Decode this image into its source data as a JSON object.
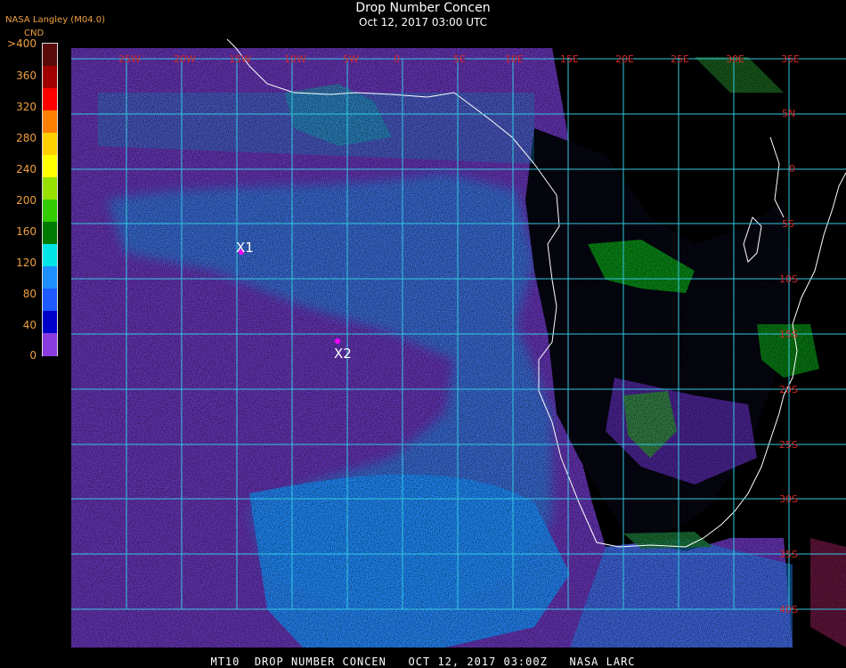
{
  "header": {
    "title": "Drop Number Concen",
    "subtitle": "Oct 12, 2017 03:00 UTC",
    "producer": "NASA Langley (M04.0)"
  },
  "colorbar": {
    "units": "CND",
    "labels": [
      ">400",
      "360",
      "320",
      "280",
      "240",
      "200",
      "160",
      "120",
      "80",
      "40",
      "0"
    ],
    "colors_top_to_bottom": [
      "#5a0a0a",
      "#a00000",
      "#ff0000",
      "#ff7f00",
      "#ffd000",
      "#ffff00",
      "#98e000",
      "#33cc00",
      "#007a00",
      "#00e6e6",
      "#1e8fff",
      "#1e5aff",
      "#0000cc",
      "#8a3ce0"
    ]
  },
  "map": {
    "lon_labels": [
      "25W",
      "20W",
      "15W",
      "10W",
      "5W",
      "0",
      "5E",
      "10E",
      "15E",
      "20E",
      "25E",
      "30E",
      "35E"
    ],
    "lat_labels": [
      "5N",
      "0",
      "5S",
      "10S",
      "15S",
      "20S",
      "25S",
      "30S",
      "35S",
      "40S"
    ],
    "markers": [
      {
        "label": "X1",
        "color": "#ff00ff"
      },
      {
        "label": "X2",
        "color": "#ff00ff"
      }
    ]
  },
  "footer": {
    "text": "MT10  DROP NUMBER CONCEN   OCT 12, 2017 03:00Z   NASA LARC"
  }
}
